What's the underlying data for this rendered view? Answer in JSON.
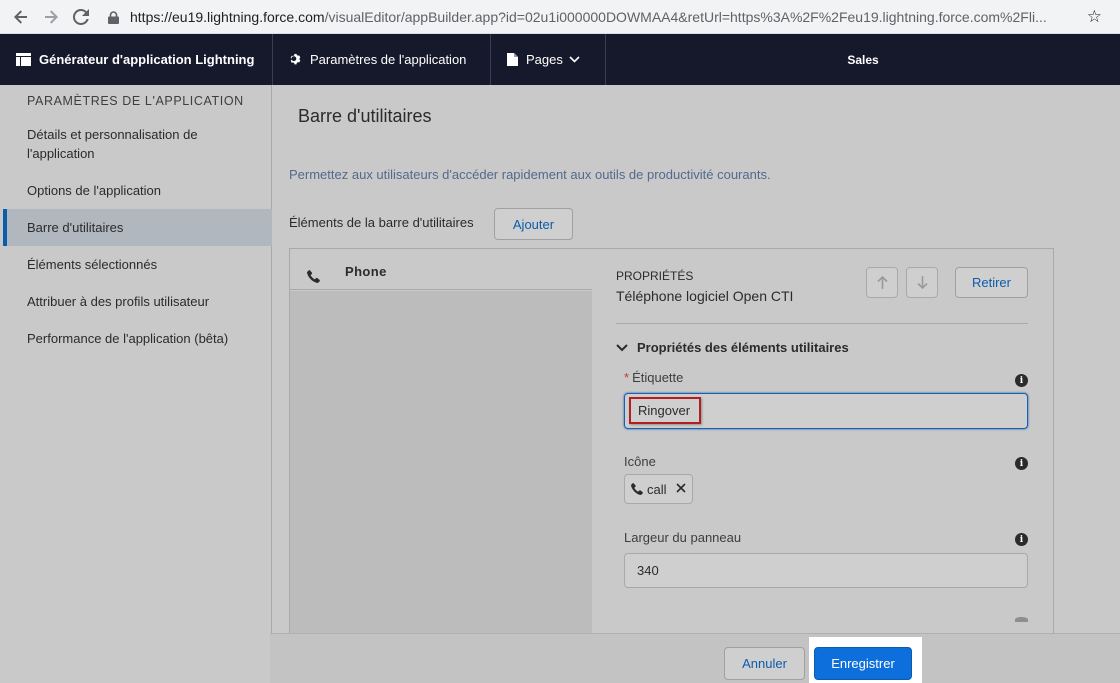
{
  "browser": {
    "url_main": "https://eu19.lightning.force.com",
    "url_rest": "/visualEditor/appBuilder.app?id=02u1i000000DOWMAA4&retUrl=https%3A%2F%2Feu19.lightning.force.com%2Fli..."
  },
  "header": {
    "title": "Générateur d'application Lightning",
    "settings_label": "Paramètres de l'application",
    "pages_label": "Pages",
    "app_name": "Sales"
  },
  "sidebar": {
    "heading": "PARAMÈTRES DE L'APPLICATION",
    "items": [
      {
        "label": "Détails et personnalisation de l'application"
      },
      {
        "label": "Options de l'application"
      },
      {
        "label": "Barre d'utilitaires"
      },
      {
        "label": "Éléments sélectionnés"
      },
      {
        "label": "Attribuer à des profils utilisateur"
      },
      {
        "label": "Performance de l'application (bêta)"
      }
    ],
    "active_index": 2
  },
  "main": {
    "title": "Barre d'utilitaires",
    "description": "Permettez aux utilisateurs d'accéder rapidement aux outils de productivité courants.",
    "items_label": "Éléments de la barre d'utilitaires",
    "add_button": "Ajouter",
    "list": [
      {
        "label": "Phone",
        "icon": "phone-icon"
      }
    ],
    "properties": {
      "heading": "PROPRIÉTÉS",
      "subtitle": "Téléphone logiciel Open CTI",
      "remove_button": "Retirer",
      "section_title": "Propriétés des éléments utilitaires",
      "label_field": {
        "label": "Étiquette",
        "required_mark": "*",
        "value": "Ringover"
      },
      "icon_field": {
        "label": "Icône",
        "value": "call"
      },
      "width_field": {
        "label": "Largeur du panneau",
        "value": "340"
      }
    }
  },
  "footer": {
    "cancel_button": "Annuler",
    "save_button": "Enregistrer"
  },
  "colors": {
    "header_bg": "#16192b",
    "accent": "#0b5cab",
    "save_bg": "#0d6fdb",
    "highlight": "#b21f1f"
  }
}
